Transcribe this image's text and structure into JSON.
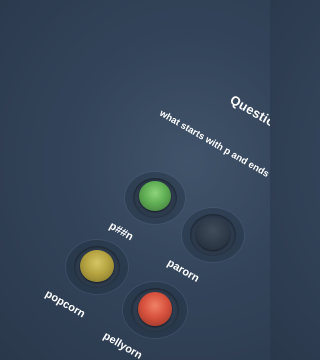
{
  "question": {
    "title": "Question",
    "text": "what starts with p and ends with n?"
  },
  "options": [
    {
      "label": "p##n",
      "color": "#5fae54",
      "rim": "#3e7238",
      "state": "green"
    },
    {
      "label": "parorn",
      "color": "#2f3a48",
      "rim": "#1f2833",
      "state": "unlit"
    },
    {
      "label": "popcorn",
      "color": "#b5a341",
      "rim": "#7c6e26",
      "state": "yellow"
    },
    {
      "label": "pellyorn",
      "color": "#d8523e",
      "rim": "#8e3024",
      "state": "red"
    }
  ]
}
